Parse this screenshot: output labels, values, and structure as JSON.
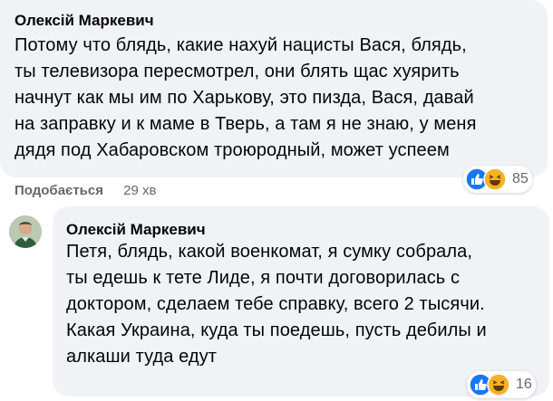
{
  "comment1": {
    "author": "Олексій Маркевич",
    "text": "Потому что блядь, какие нахуй нацисты Вася, блядь,\nты телевизора пересмотрел, они блять щас хуярить\nначнут как мы им по Харькову, это пизда, Вася, давай\nна заправку и к маме в Тверь, а там я не знаю, у меня\nдядя под Хабаровском троюродный, может успеем",
    "reactions": [
      "like",
      "haha"
    ],
    "reaction_count": "85"
  },
  "actions": {
    "like_label": "Подобається",
    "time": "29 хв"
  },
  "comment2": {
    "author": "Олексій Маркевич",
    "text": "Петя, блядь, какой военкомат, я сумку собрала,\nты едешь к тете Лиде, я почти договорилась с\nдоктором, сделаем тебе справку, всего 2 тысячи.\nКакая Украина, куда ты поедешь, пусть дебилы и\nалкаши туда едут",
    "reactions": [
      "like",
      "haha"
    ],
    "reaction_count": "16"
  },
  "colors": {
    "bubble": "#f0f2f5",
    "like": "#1877f2",
    "haha": "#f7b125",
    "muted": "#65676b"
  }
}
